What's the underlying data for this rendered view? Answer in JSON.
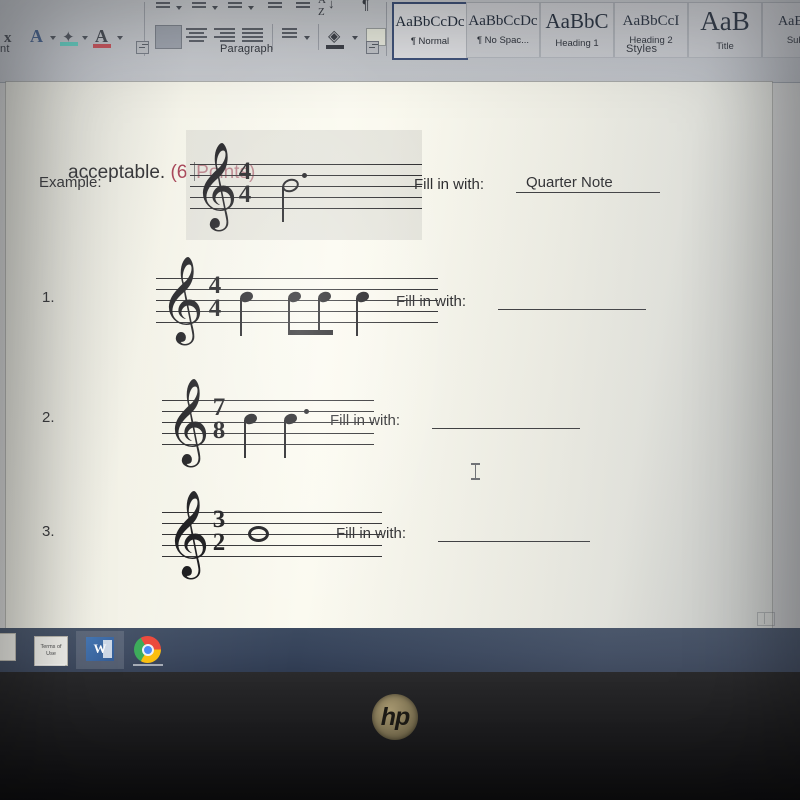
{
  "device": {
    "brand": "hp"
  },
  "ribbon": {
    "groups": [
      {
        "name": "Font",
        "label": "nt"
      },
      {
        "name": "Paragraph",
        "label": "Paragraph"
      },
      {
        "name": "Styles",
        "label": "Styles"
      }
    ],
    "font_group": {
      "superscript_label": "x",
      "text_effects_label": "A",
      "highlight_label": "ab",
      "font_color_label": "A"
    },
    "styles_gallery": [
      {
        "preview": "AaBbCcDc",
        "name": "¶ Normal",
        "selected": true,
        "preview_size": "15px"
      },
      {
        "preview": "AaBbCcDc",
        "name": "¶ No Spac...",
        "selected": false,
        "preview_size": "15px"
      },
      {
        "preview": "AaBbC",
        "name": "Heading 1",
        "selected": false,
        "preview_size": "19px"
      },
      {
        "preview": "AaBbCcI",
        "name": "Heading 2",
        "selected": false,
        "preview_size": "14px"
      },
      {
        "preview": "AaB",
        "name": "Title",
        "selected": false,
        "preview_size": "25px"
      },
      {
        "preview": "AaBbC",
        "name": "Subtit",
        "selected": false,
        "preview_size": "13px"
      }
    ]
  },
  "document": {
    "heading_prefix": "acceptable. ",
    "heading_points": "(6 ",
    "heading_points_rest": "Points)",
    "example_label": "Example:",
    "fill_label": "Fill in with:",
    "example_answer": "Quarter Note",
    "questions": [
      {
        "number": "1.",
        "time_signature": {
          "top": "4",
          "bottom": "4"
        },
        "notes": "quarter, two beamed eighths, quarter",
        "answer": ""
      },
      {
        "number": "2.",
        "time_signature": {
          "top": "7",
          "bottom": "8"
        },
        "notes": "quarter, dotted quarter",
        "answer": ""
      },
      {
        "number": "3.",
        "time_signature": {
          "top": "3",
          "bottom": "2"
        },
        "notes": "whole note",
        "answer": ""
      }
    ],
    "example": {
      "time_signature": {
        "top": "4",
        "bottom": "4"
      },
      "notes": "dotted half note"
    },
    "clef_glyph": "𝄞"
  },
  "taskbar": {
    "items": [
      {
        "name": "terms-of-use-document",
        "label": "Terms of Use",
        "active": false
      },
      {
        "name": "microsoft-word",
        "label": "W",
        "active": true
      },
      {
        "name": "google-chrome",
        "label": "",
        "active": false
      }
    ]
  },
  "colors": {
    "accent_red": "#a23a4e",
    "page_background": "#f7f6eb",
    "taskbar": "#36435a",
    "ribbon": "#c9ccd1",
    "ink": "#17171a"
  }
}
